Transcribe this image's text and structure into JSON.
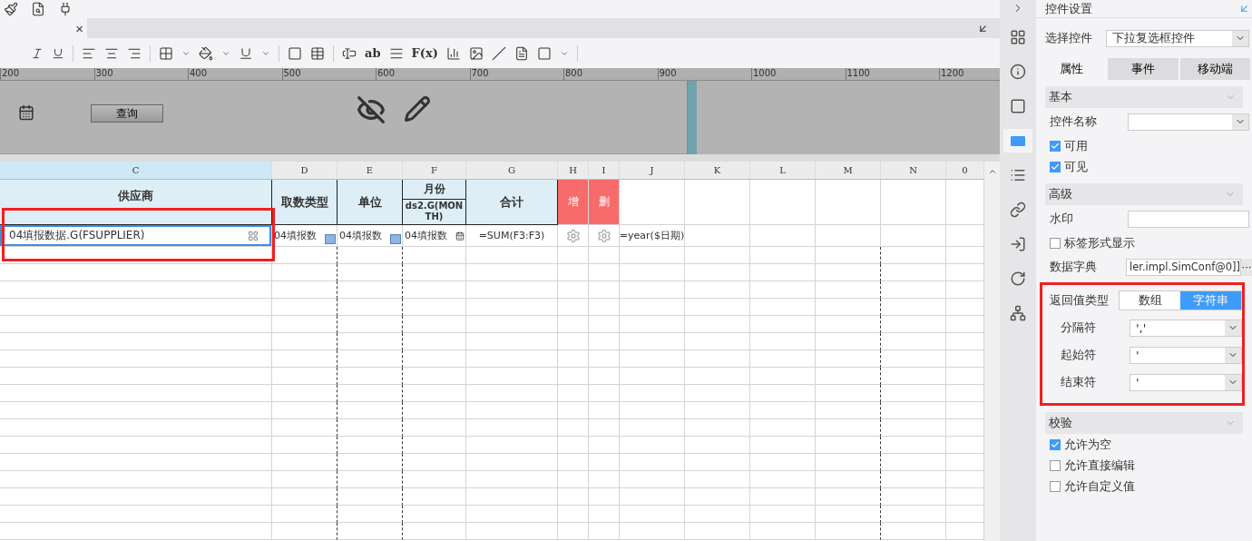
{
  "document_tab": {
    "close": "×"
  },
  "format_toolbar": {
    "text_tool": "ab",
    "formula_tool": "F(x)"
  },
  "ruler": [
    "200",
    "300",
    "400",
    "500",
    "600",
    "700",
    "800",
    "900",
    "1000",
    "1100",
    "1200"
  ],
  "parameter_panel": {
    "query_button": "查询"
  },
  "sheet": {
    "columns": [
      {
        "label": "C",
        "selected": true
      },
      {
        "label": "D",
        "selected": false
      },
      {
        "label": "E",
        "selected": false
      },
      {
        "label": "F",
        "selected": false
      },
      {
        "label": "G",
        "selected": false
      },
      {
        "label": "H",
        "selected": false
      },
      {
        "label": "I",
        "selected": false
      },
      {
        "label": "J",
        "selected": false
      },
      {
        "label": "K",
        "selected": false
      },
      {
        "label": "L",
        "selected": false
      },
      {
        "label": "M",
        "selected": false
      },
      {
        "label": "N",
        "selected": false
      },
      {
        "label": "0",
        "selected": false
      }
    ],
    "header_row": [
      {
        "kind": "header",
        "text": "供应商"
      },
      {
        "kind": "header",
        "text": "取数类型"
      },
      {
        "kind": "header",
        "text": "单位"
      },
      {
        "kind": "split",
        "text": "月份",
        "sub": "ds2.G(MONTH)"
      },
      {
        "kind": "header",
        "text": "合计"
      },
      {
        "kind": "action",
        "text": "增"
      },
      {
        "kind": "action",
        "text": "删"
      }
    ],
    "data_row": [
      {
        "kind": "editor",
        "text": "04填报数据.G(FSUPPLIER)",
        "selected": true
      },
      {
        "kind": "combo",
        "text": "04填报数",
        "selected": false
      },
      {
        "kind": "combo",
        "text": "04填报数",
        "selected": false
      },
      {
        "kind": "date",
        "text": "04填报数",
        "selected": false
      },
      {
        "kind": "formula",
        "text": "=SUM(F3:F3)",
        "selected": false
      },
      {
        "kind": "gear",
        "selected": false
      },
      {
        "kind": "gear",
        "selected": false
      },
      {
        "kind": "formula",
        "text": "=year($日期)",
        "selected": false
      }
    ]
  },
  "settings": {
    "title": "控件设置",
    "select_label": "选择控件",
    "select_value": "下拉复选框控件",
    "tabs": [
      {
        "label": "属性",
        "selected": true
      },
      {
        "label": "事件",
        "selected": false
      },
      {
        "label": "移动端",
        "selected": false
      }
    ],
    "sections": [
      {
        "title": "基本",
        "items": [
          {
            "kind": "field",
            "label": "控件名称",
            "dropdown": true
          },
          {
            "kind": "check",
            "label": "可用",
            "checked": true
          },
          {
            "kind": "check",
            "label": "可见",
            "checked": true
          }
        ]
      },
      {
        "title": "高级",
        "items": [
          {
            "kind": "field",
            "label": "水印",
            "dropdown": false
          },
          {
            "kind": "check",
            "label": "标签形式显示",
            "checked": false
          },
          {
            "kind": "dict",
            "label": "数据字典",
            "value": "ler.impl.SimConf@0]]",
            "button": "···"
          },
          {
            "kind": "segment",
            "label": "返回值类型",
            "options": [
              {
                "label": "数组",
                "selected": false
              },
              {
                "label": "字符串",
                "selected": true
              }
            ]
          },
          {
            "kind": "sub",
            "label": "分隔符",
            "value": "','"
          },
          {
            "kind": "sub",
            "label": "起始符",
            "value": "'"
          },
          {
            "kind": "sub",
            "label": "结束符",
            "value": "'"
          }
        ]
      },
      {
        "title": "校验",
        "items": [
          {
            "kind": "check",
            "label": "允许为空",
            "checked": true
          },
          {
            "kind": "check",
            "label": "允许直接编辑",
            "checked": false
          },
          {
            "kind": "check",
            "label": "允许自定义值",
            "checked": false
          }
        ]
      }
    ]
  }
}
